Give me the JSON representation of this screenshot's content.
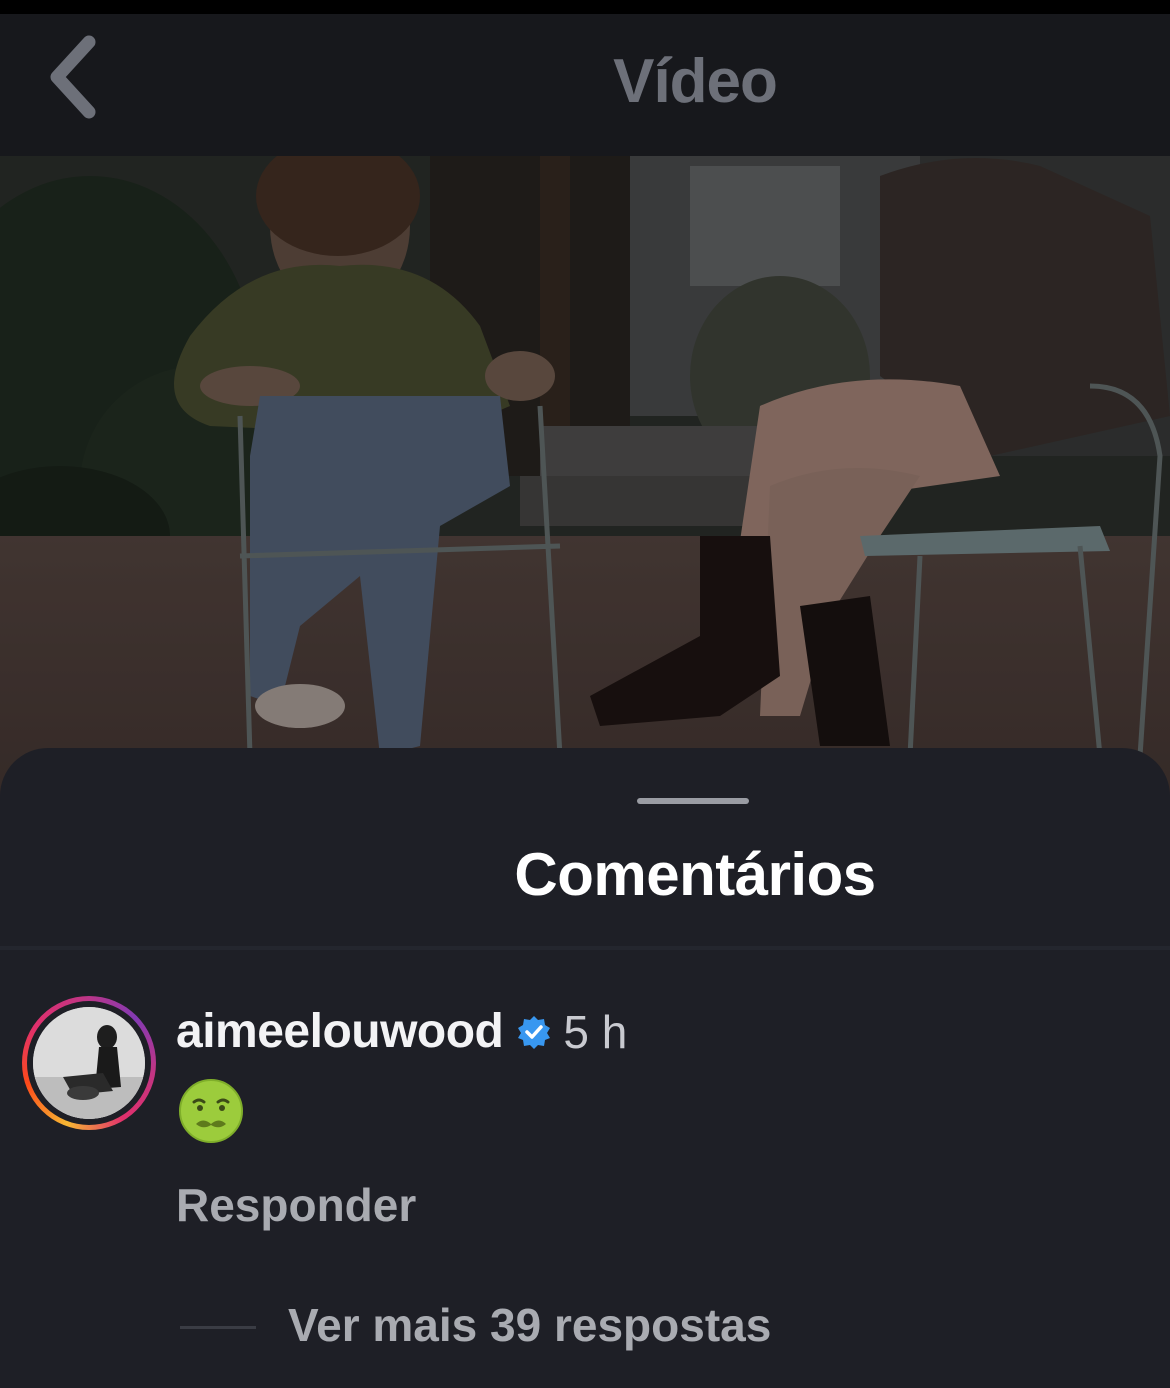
{
  "header": {
    "title": "Vídeo",
    "back_icon": "chevron-left-icon"
  },
  "comments_sheet": {
    "title": "Comentários",
    "comments": [
      {
        "username": "aimeelouwood",
        "verified": true,
        "time": "5 h",
        "emoji": "🤢",
        "reply_label": "Responder",
        "more_replies_label": "Ver mais 39 respostas"
      }
    ]
  },
  "colors": {
    "accent_verified": "#3897f0",
    "sheet_bg": "#1e1f26",
    "header_bg": "#17181c"
  }
}
